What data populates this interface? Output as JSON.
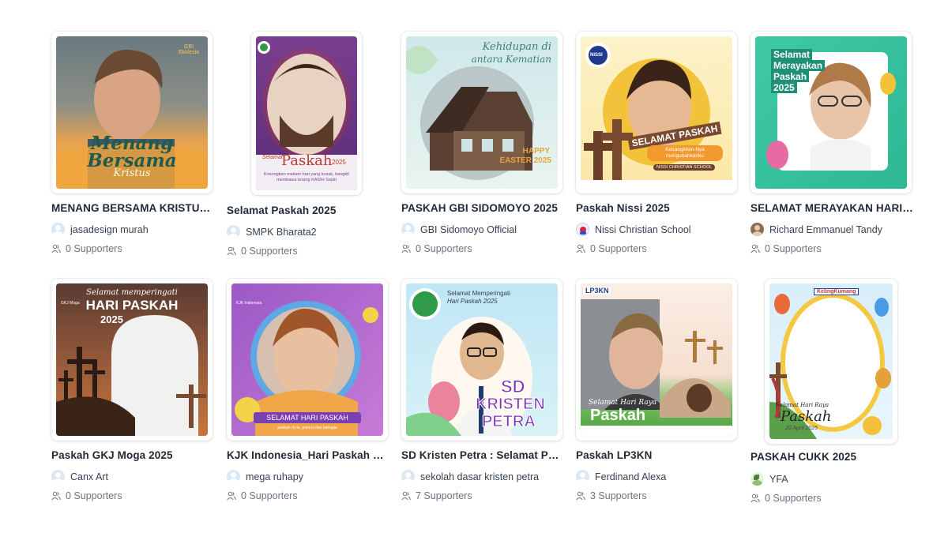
{
  "colors": {
    "text": "#1f2937",
    "muted": "#6b7280",
    "avatar_bg": "#dbe8f3",
    "card_bg": "#ffffff"
  },
  "icons": {
    "supporters": "users-icon",
    "avatar_default": "user-avatar-icon"
  },
  "campaigns": [
    {
      "title": "MENANG BERSAMA KRISTUS (P...",
      "author": "jasadesign murah",
      "supporters": "0 Supporters",
      "thumb_text": [
        "Menang",
        "Bersama",
        "Kristus",
        "GBI Ekklesia"
      ]
    },
    {
      "title": "Selamat Paskah 2025",
      "author": "SMPK Bharata2",
      "supporters": "0 Supporters",
      "thumb_text": [
        "Selamat",
        "Paskah",
        "2025",
        "Kosongkan makam hari yang kosak, bangkit membawa terang KASIH Sejati"
      ]
    },
    {
      "title": "PASKAH GBI SIDOMOYO 2025",
      "author": "GBI Sidomoyo Official",
      "supporters": "0 Supporters",
      "thumb_text": [
        "Kehidupan di",
        "antara Kematian",
        "HAPPY",
        "EASTER 2025"
      ]
    },
    {
      "title": "Paskah Nissi 2025",
      "author": "Nissi Christian School",
      "supporters": "0 Supporters",
      "thumb_text": [
        "NISSI",
        "SELAMAT PASKAH",
        "Kebangkitan-Nya mengubahkanku",
        "NISSI CHRISTIAN SCHOOL"
      ]
    },
    {
      "title": "SELAMAT MERAYAKAN HARI PA...",
      "author": "Richard Emmanuel Tandy",
      "supporters": "0 Supporters",
      "thumb_text": [
        "Selamat",
        "Merayakan",
        "Paskah",
        "2025"
      ]
    },
    {
      "title": "Paskah GKJ Moga 2025",
      "author": "Canx Art",
      "supporters": "0 Supporters",
      "thumb_text": [
        "Selamat memperingati",
        "HARI PASKAH",
        "2025",
        "GKJ Moga"
      ]
    },
    {
      "title": "KJK Indonesia_Hari Paskah 20...",
      "author": "mega ruhapy",
      "supporters": "0 Supporters",
      "thumb_text": [
        "KJK Indonesia",
        "SELAMAT HARI PASKAH",
        "paskah di rie, pamrul dan bahagia"
      ]
    },
    {
      "title": "SD Kristen Petra : Selamat Pas...",
      "author": "sekolah dasar kristen petra",
      "supporters": "7 Supporters",
      "thumb_text": [
        "Selamat Memperingati",
        "Hari Paskah 2025",
        "SD",
        "KRISTEN",
        "PETRA"
      ]
    },
    {
      "title": "Paskah LP3KN",
      "author": "Ferdinand Alexa",
      "supporters": "3 Supporters",
      "thumb_text": [
        "LP3KN",
        "Selamat Hari Raya",
        "Paskah"
      ]
    },
    {
      "title": "PASKAH CUKK 2025",
      "author": "YFA",
      "supporters": "0 Supporters",
      "thumb_text": [
        "KelingKumang",
        "Selamat Hari Raya",
        "Paskah",
        "20 April 2025"
      ]
    }
  ]
}
